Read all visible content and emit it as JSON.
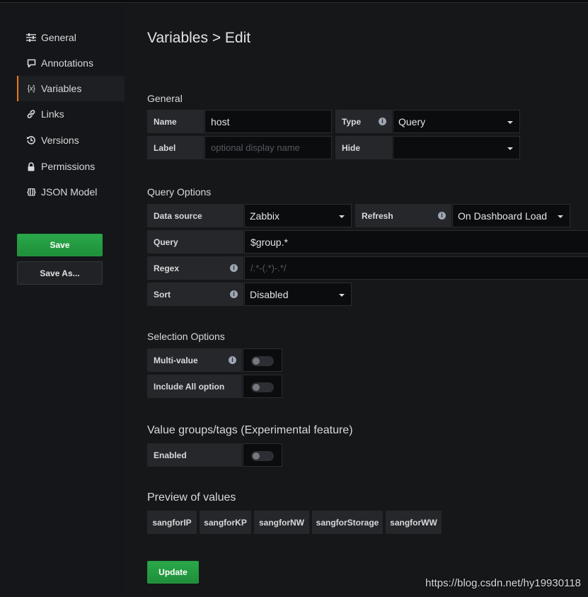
{
  "sidebar": {
    "items": [
      {
        "label": "General",
        "icon": "sliders-icon"
      },
      {
        "label": "Annotations",
        "icon": "comment-icon"
      },
      {
        "label": "Variables",
        "icon": "variable-icon",
        "active": true
      },
      {
        "label": "Links",
        "icon": "link-icon"
      },
      {
        "label": "Versions",
        "icon": "history-icon"
      },
      {
        "label": "Permissions",
        "icon": "lock-icon"
      },
      {
        "label": "JSON Model",
        "icon": "json-icon"
      }
    ],
    "save_label": "Save",
    "save_as_label": "Save As..."
  },
  "page": {
    "title": "Variables > Edit"
  },
  "general": {
    "heading": "General",
    "name_label": "Name",
    "name_value": "host",
    "type_label": "Type",
    "type_value": "Query",
    "label_label": "Label",
    "label_placeholder": "optional display name",
    "hide_label": "Hide",
    "hide_value": ""
  },
  "query_options": {
    "heading": "Query Options",
    "datasource_label": "Data source",
    "datasource_value": "Zabbix",
    "refresh_label": "Refresh",
    "refresh_value": "On Dashboard Load",
    "query_label": "Query",
    "query_value": "$group.*",
    "regex_label": "Regex",
    "regex_placeholder": "/.*-(.*)-.*/",
    "sort_label": "Sort",
    "sort_value": "Disabled"
  },
  "selection_options": {
    "heading": "Selection Options",
    "multi_value_label": "Multi-value",
    "include_all_label": "Include All option",
    "multi_value_on": false,
    "include_all_on": false
  },
  "value_groups": {
    "heading": "Value groups/tags (Experimental feature)",
    "enabled_label": "Enabled",
    "enabled_on": false
  },
  "preview": {
    "heading": "Preview of values",
    "values": [
      "sangforIP",
      "sangforKP",
      "sangforNW",
      "sangforStorage",
      "sangforWW"
    ]
  },
  "update_label": "Update",
  "watermark": "https://blog.csdn.net/hy19930118",
  "colors": {
    "accent_active": "#eb7b18",
    "primary_button": "#24993f",
    "background": "#161719"
  }
}
